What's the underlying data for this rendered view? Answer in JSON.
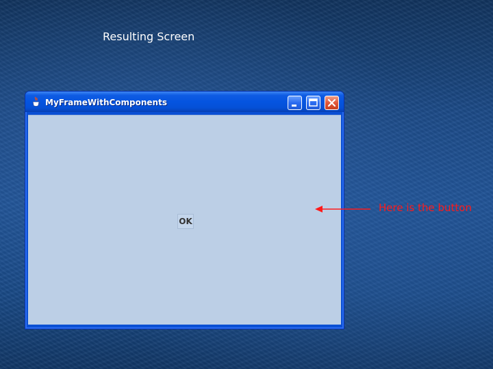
{
  "slide": {
    "title": "Resulting Screen",
    "annotation": "Here is the button"
  },
  "window": {
    "title": "MyFrameWithComponents",
    "icon": "java-cup-icon",
    "controls": [
      "minimize-icon",
      "maximize-icon",
      "close-icon"
    ],
    "ok_button_label": "OK"
  },
  "colors": {
    "background": "#1f5294",
    "title_bar": "#0554e0",
    "client_area": "#bccfe6",
    "annotation": "#ff1a1a"
  }
}
